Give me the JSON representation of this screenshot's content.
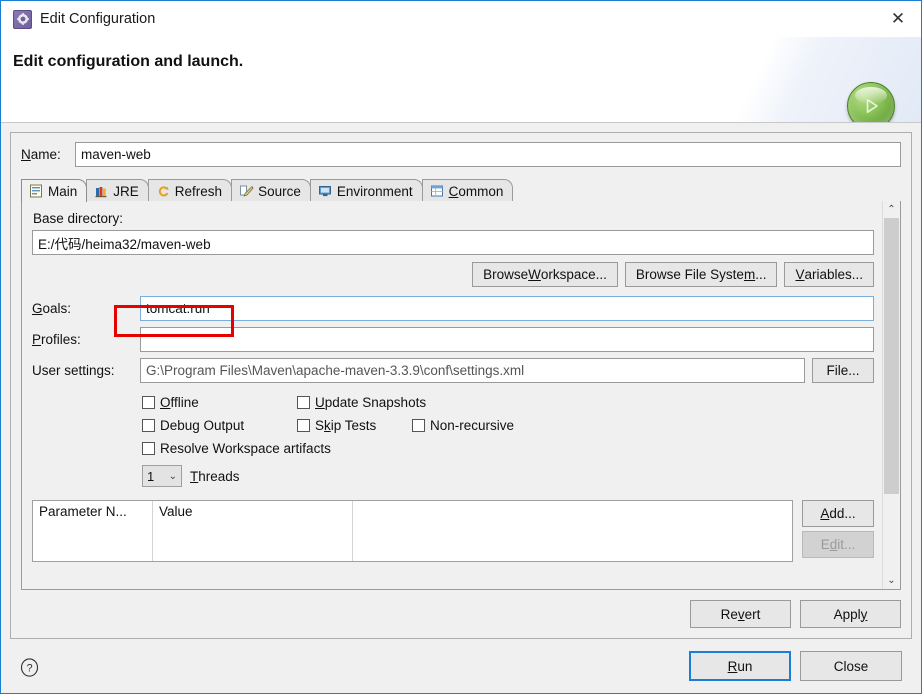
{
  "window": {
    "title": "Edit Configuration",
    "title_icon": "gear-icon",
    "close_icon": "✕"
  },
  "header": {
    "title": "Edit configuration and launch.",
    "run_icon": "play-icon"
  },
  "name_field": {
    "label": "Name:",
    "mnemonic": "N",
    "label_rest": "ame:",
    "value": "maven-web"
  },
  "tabs": [
    {
      "label": "Main",
      "icon": "form-icon",
      "active": true
    },
    {
      "label": "JRE",
      "icon": "books-icon",
      "active": false
    },
    {
      "label": "Refresh",
      "icon": "refresh-icon",
      "active": false
    },
    {
      "label": "Source",
      "icon": "source-pencil-icon",
      "active": false
    },
    {
      "label": "Environment",
      "icon": "monitor-icon",
      "active": false
    },
    {
      "label": "Common",
      "icon": "table-icon",
      "active": false,
      "mnemonic": "C",
      "label_rest": "ommon"
    }
  ],
  "main_tab": {
    "base_directory": {
      "label": "Base directory:",
      "value": "E:/代码/heima32/maven-web"
    },
    "browse_buttons": [
      {
        "name": "browse-workspace-button",
        "pre": "Browse ",
        "mnemonic": "W",
        "post": "orkspace..."
      },
      {
        "name": "browse-file-system-button",
        "pre": "Browse File Syste",
        "mnemonic": "m",
        "post": "..."
      },
      {
        "name": "variables-button",
        "pre": "",
        "mnemonic": "V",
        "post": "ariables..."
      }
    ],
    "goals": {
      "label_mnemonic": "G",
      "label_rest": "oals:",
      "value": "tomcat:run",
      "highlight_color": "#e60000"
    },
    "profiles": {
      "label_mnemonic": "P",
      "label_rest": "rofiles:",
      "value": ""
    },
    "user_settings": {
      "label": "User settings:",
      "value": "G:\\Program Files\\Maven\\apache-maven-3.3.9\\conf\\settings.xml",
      "button_label": "File..."
    },
    "checkboxes": [
      {
        "name": "offline-checkbox",
        "mnemonic": "O",
        "label_rest": "ffline",
        "checked": false
      },
      {
        "name": "update-snapshots-checkbox",
        "mnemonic": "U",
        "label_rest": "pdate Snapshots",
        "checked": false
      },
      {
        "name": "debug-output-checkbox",
        "pre": "Debu",
        "mnemonic": "g",
        "label_rest": " Output",
        "checked": false
      },
      {
        "name": "skip-tests-checkbox",
        "pre": "S",
        "mnemonic": "k",
        "label_rest": "ip Tests",
        "checked": false
      },
      {
        "name": "non-recursive-checkbox",
        "pre": "",
        "mnemonic": "",
        "label_rest": "Non-recursive",
        "checked": false
      },
      {
        "name": "resolve-workspace-artifacts-checkbox",
        "pre": "",
        "mnemonic": "",
        "label_rest": "Resolve Workspace artifacts",
        "checked": false
      }
    ],
    "threads": {
      "value": "1",
      "chevron": "⌄",
      "mnemonic": "T",
      "label_rest": "hreads"
    },
    "parameter_table": {
      "columns": [
        "Parameter N...",
        "Value",
        ""
      ],
      "rows": [],
      "add_button": {
        "mnemonic": "A",
        "rest": "dd..."
      },
      "edit_button": {
        "pre": "E",
        "mnemonic": "d",
        "rest": "it...",
        "disabled": true
      }
    },
    "scrollbar": {
      "up": "⌃",
      "down": "⌄"
    }
  },
  "panel_buttons": [
    {
      "name": "revert-button",
      "pre": "Re",
      "mnemonic": "v",
      "post": "ert",
      "disabled": false
    },
    {
      "name": "apply-button",
      "pre": "Appl",
      "mnemonic": "y",
      "post": "",
      "disabled": false
    }
  ],
  "footer": {
    "help_icon": "question-mark-icon",
    "run_button": {
      "pre": "",
      "mnemonic": "R",
      "post": "un",
      "focused": true
    },
    "close_button": {
      "pre": "Close",
      "mnemonic": "",
      "post": ""
    }
  },
  "colors": {
    "window_border": "#1a7fd4",
    "accent_focus": "#1a7fd4",
    "annotation": "#e60000",
    "panel_bg": "#f0f0f0",
    "field_bg": "#ffffff"
  }
}
